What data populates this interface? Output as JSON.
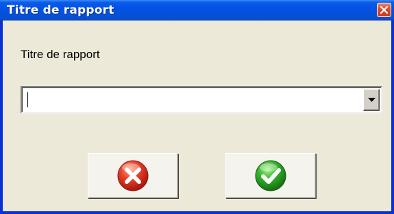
{
  "window": {
    "title": "Titre de rapport"
  },
  "dialog": {
    "prompt_label": "Titre de rapport",
    "combo_value": "",
    "combo_placeholder": ""
  },
  "buttons": {
    "cancel_icon": "red-x-circle-icon",
    "ok_icon": "green-check-circle-icon"
  },
  "colors": {
    "titlebar": "#0452e6",
    "frame": "#0831d9",
    "dialog_bg": "#ece9d8",
    "cancel_red": "#e32b1f",
    "ok_green": "#2fae2a"
  }
}
